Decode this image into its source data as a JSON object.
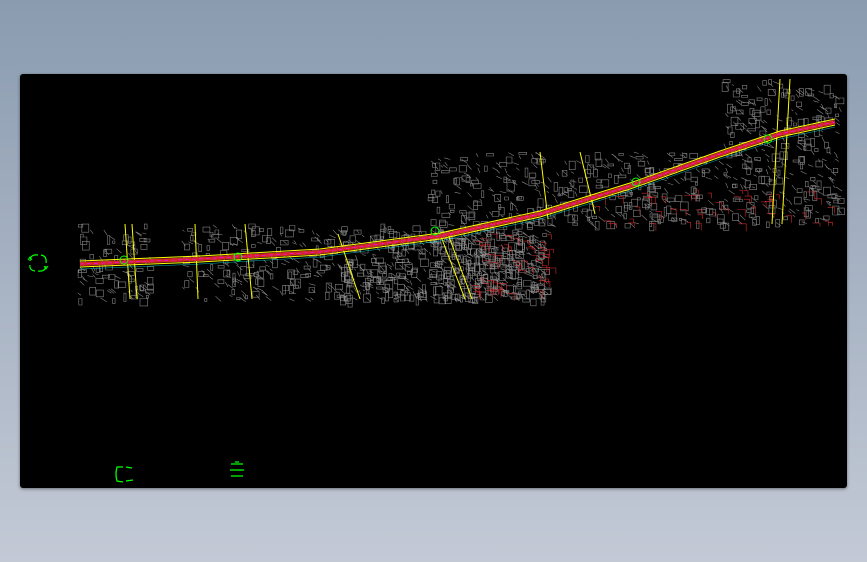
{
  "window": {
    "background": "#8a9bb0"
  },
  "viewport": {
    "background": "#000000"
  },
  "drawing": {
    "layer_colors": {
      "buildings": "#9a9a9a",
      "road_main": "#d02828",
      "road_edge": "#ffff00",
      "centerline": "#ff00ff",
      "markers": "#00ff00",
      "cyan": "#00ffff"
    },
    "symbols": [
      {
        "name": "north-arrow-symbol",
        "icon": "circle-arrows-icon"
      },
      {
        "name": "legend-bracket-left",
        "icon": "bracket-icon"
      },
      {
        "name": "legend-bracket-right",
        "icon": "bracket-icon"
      }
    ]
  }
}
